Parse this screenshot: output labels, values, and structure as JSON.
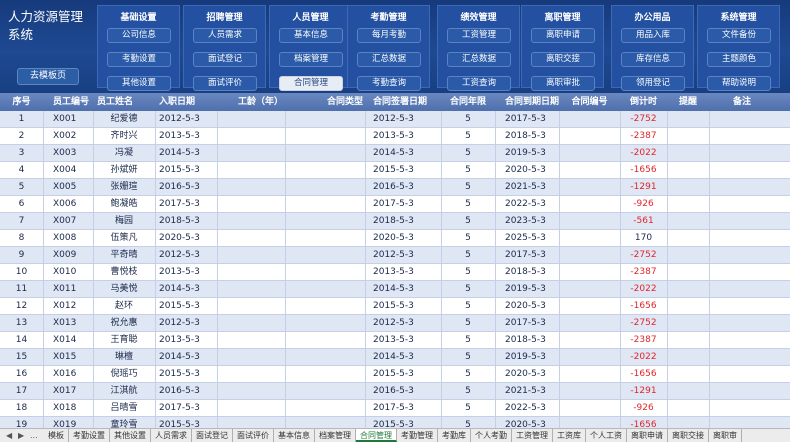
{
  "system": {
    "title": "人力资源管理系统",
    "home_button": "去模板页"
  },
  "modules": [
    {
      "title": "基础设置",
      "buttons": [
        "公司信息",
        "考勤设置",
        "其他设置"
      ]
    },
    {
      "title": "招聘管理",
      "buttons": [
        "人员需求",
        "面试登记",
        "面试评价"
      ]
    },
    {
      "title": "人员管理",
      "buttons": [
        "基本信息",
        "档案管理",
        "合同管理"
      ]
    },
    {
      "title": "考勤管理",
      "buttons": [
        "每月考勤",
        "汇总数据",
        "考勤查询"
      ]
    },
    {
      "title": "绩效管理",
      "buttons": [
        "工资管理",
        "汇总数据",
        "工资查询"
      ]
    },
    {
      "title": "离职管理",
      "buttons": [
        "离职申请",
        "离职交接",
        "离职审批"
      ]
    },
    {
      "title": "办公用品",
      "buttons": [
        "用品入库",
        "库存信息",
        "领用登记"
      ]
    },
    {
      "title": "系统管理",
      "buttons": [
        "文件备份",
        "主题颜色",
        "帮助说明"
      ]
    }
  ],
  "active_module_button": "合同管理",
  "table": {
    "headers": [
      "序号",
      "员工编号",
      "员工姓名",
      "入职日期",
      "工龄（年）",
      "合同类型",
      "合同签署日期",
      "合同年限",
      "合同到期日期",
      "合同编号",
      "倒计时",
      "提醒",
      "备注"
    ],
    "rows": [
      [
        "1",
        "X001",
        "纪爱德",
        "2012-5-3",
        "",
        "",
        "2012-5-3",
        "5",
        "2017-5-3",
        "",
        "-2752",
        "",
        ""
      ],
      [
        "2",
        "X002",
        "齐时兴",
        "2013-5-3",
        "",
        "",
        "2013-5-3",
        "5",
        "2018-5-3",
        "",
        "-2387",
        "",
        ""
      ],
      [
        "3",
        "X003",
        "冯凝",
        "2014-5-3",
        "",
        "",
        "2014-5-3",
        "5",
        "2019-5-3",
        "",
        "-2022",
        "",
        ""
      ],
      [
        "4",
        "X004",
        "孙斌妍",
        "2015-5-3",
        "",
        "",
        "2015-5-3",
        "5",
        "2020-5-3",
        "",
        "-1656",
        "",
        ""
      ],
      [
        "5",
        "X005",
        "张姗瑄",
        "2016-5-3",
        "",
        "",
        "2016-5-3",
        "5",
        "2021-5-3",
        "",
        "-1291",
        "",
        ""
      ],
      [
        "6",
        "X006",
        "鲍凝皓",
        "2017-5-3",
        "",
        "",
        "2017-5-3",
        "5",
        "2022-5-3",
        "",
        "-926",
        "",
        ""
      ],
      [
        "7",
        "X007",
        "梅园",
        "2018-5-3",
        "",
        "",
        "2018-5-3",
        "5",
        "2023-5-3",
        "",
        "-561",
        "",
        ""
      ],
      [
        "8",
        "X008",
        "伍策凡",
        "2020-5-3",
        "",
        "",
        "2020-5-3",
        "5",
        "2025-5-3",
        "",
        "170",
        "",
        ""
      ],
      [
        "9",
        "X009",
        "平奇晴",
        "2012-5-3",
        "",
        "",
        "2012-5-3",
        "5",
        "2017-5-3",
        "",
        "-2752",
        "",
        ""
      ],
      [
        "10",
        "X010",
        "曹悦枝",
        "2013-5-3",
        "",
        "",
        "2013-5-3",
        "5",
        "2018-5-3",
        "",
        "-2387",
        "",
        ""
      ],
      [
        "11",
        "X011",
        "马美悦",
        "2014-5-3",
        "",
        "",
        "2014-5-3",
        "5",
        "2019-5-3",
        "",
        "-2022",
        "",
        ""
      ],
      [
        "12",
        "X012",
        "赵环",
        "2015-5-3",
        "",
        "",
        "2015-5-3",
        "5",
        "2020-5-3",
        "",
        "-1656",
        "",
        ""
      ],
      [
        "13",
        "X013",
        "祝允惠",
        "2012-5-3",
        "",
        "",
        "2012-5-3",
        "5",
        "2017-5-3",
        "",
        "-2752",
        "",
        ""
      ],
      [
        "14",
        "X014",
        "王育聪",
        "2013-5-3",
        "",
        "",
        "2013-5-3",
        "5",
        "2018-5-3",
        "",
        "-2387",
        "",
        ""
      ],
      [
        "15",
        "X015",
        "琳檀",
        "2014-5-3",
        "",
        "",
        "2014-5-3",
        "5",
        "2019-5-3",
        "",
        "-2022",
        "",
        ""
      ],
      [
        "16",
        "X016",
        "倪瑶巧",
        "2015-5-3",
        "",
        "",
        "2015-5-3",
        "5",
        "2020-5-3",
        "",
        "-1656",
        "",
        ""
      ],
      [
        "17",
        "X017",
        "江淇航",
        "2016-5-3",
        "",
        "",
        "2016-5-3",
        "5",
        "2021-5-3",
        "",
        "-1291",
        "",
        ""
      ],
      [
        "18",
        "X018",
        "吕晴雪",
        "2017-5-3",
        "",
        "",
        "2017-5-3",
        "5",
        "2022-5-3",
        "",
        "-926",
        "",
        ""
      ],
      [
        "19",
        "X019",
        "童玲雪",
        "2015-5-3",
        "",
        "",
        "2015-5-3",
        "5",
        "2020-5-3",
        "",
        "-1656",
        "",
        ""
      ]
    ]
  },
  "sheet_tabs": {
    "nav": [
      "◀",
      "▶",
      "..."
    ],
    "tabs": [
      "模板",
      "考勤设置",
      "其他设置",
      "人员需求",
      "面试登记",
      "面试评价",
      "基本信息",
      "档案管理",
      "合同管理",
      "考勤管理",
      "考勤库",
      "个人考勤",
      "工资管理",
      "工资库",
      "个人工资",
      "离职申请",
      "离职交接",
      "离职审"
    ],
    "active": "合同管理"
  },
  "colors": {
    "banner": "#1e4a92",
    "header_row": "#5a7ab5",
    "stripe": "#dfe6f4",
    "negative": "#e0262b",
    "active_tab": "#1f7a3a"
  }
}
